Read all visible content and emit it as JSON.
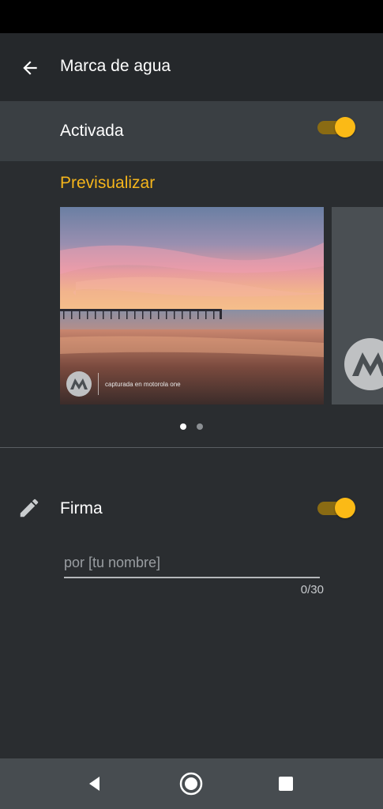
{
  "app_bar": {
    "title": "Marca de agua",
    "back_icon": "arrow-back-icon"
  },
  "activated": {
    "label": "Activada",
    "enabled": true
  },
  "preview": {
    "heading": "Previsualizar",
    "watermark_text": "capturada en motorola one",
    "pages": 2,
    "current_page": 1
  },
  "signature": {
    "icon": "pencil-icon",
    "label": "Firma",
    "enabled": true,
    "input_value": "",
    "placeholder": "por [tu nombre]",
    "counter": "0/30"
  },
  "nav": {
    "back_icon": "nav-back-icon",
    "home_icon": "nav-home-icon",
    "recent_icon": "nav-recents-icon"
  },
  "colors": {
    "accent": "#f5b51b",
    "background": "#2a2d30",
    "highlight_row": "#3a3f43"
  }
}
